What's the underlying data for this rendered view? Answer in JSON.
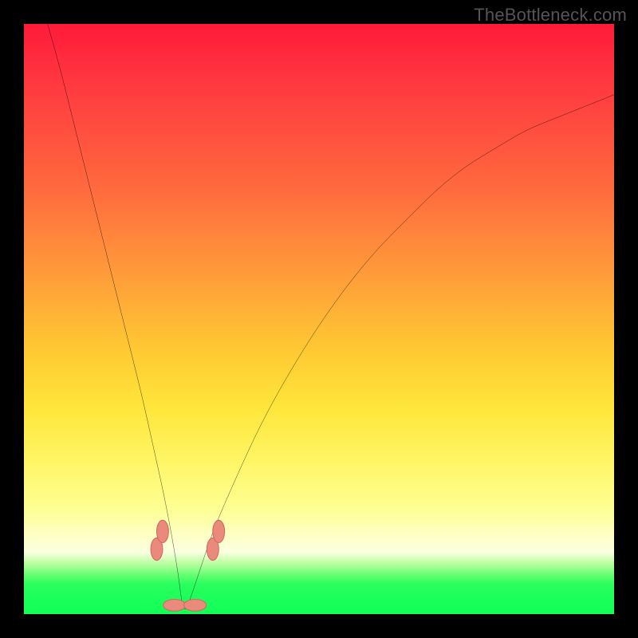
{
  "attribution": "TheBottleneck.com",
  "colors": {
    "frame": "#000000",
    "curve": "#000000",
    "marker_fill": "#e98a7d",
    "marker_stroke": "#d46a5e",
    "gradient_stops": [
      {
        "pct": 0,
        "hex": "#ff1a3a"
      },
      {
        "pct": 10,
        "hex": "#ff3840"
      },
      {
        "pct": 28,
        "hex": "#ff6a3e"
      },
      {
        "pct": 42,
        "hex": "#ff9a3a"
      },
      {
        "pct": 55,
        "hex": "#ffc833"
      },
      {
        "pct": 65,
        "hex": "#ffe63a"
      },
      {
        "pct": 74,
        "hex": "#fff565"
      },
      {
        "pct": 82,
        "hex": "#fdff91"
      },
      {
        "pct": 87,
        "hex": "#feffc8"
      },
      {
        "pct": 89.5,
        "hex": "#fbffe0"
      },
      {
        "pct": 91.5,
        "hex": "#b7ff9e"
      },
      {
        "pct": 93.5,
        "hex": "#60ff70"
      },
      {
        "pct": 95,
        "hex": "#28ff5e"
      },
      {
        "pct": 100,
        "hex": "#10ff56"
      }
    ]
  },
  "chart_data": {
    "type": "line",
    "title": "",
    "xlabel": "",
    "ylabel": "",
    "xlim": [
      0,
      100
    ],
    "ylim": [
      0,
      100
    ],
    "note": "V-shaped bottleneck curve. x≈% of axis width, y≈bottleneck % (0=green bottom, 100=red top). Minimum ≈ (27, 0). Values estimated from pixels; no axis ticks shown.",
    "series": [
      {
        "name": "bottleneck-curve",
        "x": [
          4,
          6,
          8,
          10,
          12,
          14,
          16,
          18,
          20,
          22,
          24,
          26,
          27,
          28,
          30,
          32,
          35,
          40,
          45,
          50,
          55,
          60,
          65,
          70,
          75,
          80,
          85,
          90,
          95,
          100
        ],
        "y": [
          100,
          93,
          85,
          77,
          69,
          61,
          53,
          45,
          37,
          28,
          19,
          8,
          0,
          2,
          8,
          14,
          21,
          32,
          41,
          49,
          56,
          62,
          67,
          72,
          76,
          79,
          82,
          84,
          86,
          88
        ]
      }
    ],
    "markers": [
      {
        "name": "left-rising-pair-lower",
        "x": 22.5,
        "y": 11
      },
      {
        "name": "left-rising-pair-upper",
        "x": 23.5,
        "y": 14
      },
      {
        "name": "valley-left",
        "x": 25.5,
        "y": 1.5
      },
      {
        "name": "valley-right",
        "x": 29,
        "y": 1.5
      },
      {
        "name": "right-rising-pair-lower",
        "x": 32,
        "y": 11
      },
      {
        "name": "right-rising-pair-upper",
        "x": 33,
        "y": 14
      }
    ]
  }
}
